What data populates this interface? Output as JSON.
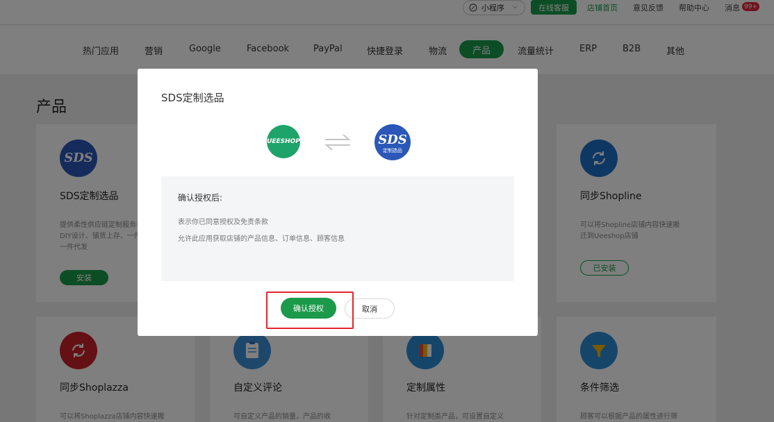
{
  "topbar": {
    "mini_program_label": "小程序",
    "online_service_label": "在线客服",
    "store_home_label": "店铺首页",
    "feedback_label": "意见反馈",
    "help_label": "帮助中心",
    "messages_label": "消息",
    "messages_badge": "99+"
  },
  "nav": {
    "items": [
      "热门应用",
      "营销",
      "Google",
      "Facebook",
      "PayPal",
      "快捷登录",
      "物流",
      "产品",
      "流量统计",
      "ERP",
      "B2B",
      "其他"
    ],
    "active": "产品"
  },
  "page": {
    "section_title": "产品",
    "cards": [
      {
        "name": "SDS定制选品",
        "desc": "提供柔性供应链定制服务丰富，DIY设计、铺货上存、一件起订、一件代发",
        "button": "安装"
      },
      {
        "name": "同步Shopline",
        "desc": "可以将Shopline店铺内容快速搬迁到Ueeshop店铺",
        "button": "已安装"
      },
      {
        "name": "同步Shoplazza",
        "desc": "可以将Shoplazza店铺内容快速搬"
      },
      {
        "name": "自定义评论",
        "desc": "可自定义产品的销量，产品的收"
      },
      {
        "name": "定制属性",
        "desc": "针对定制类产品，可设置自定义"
      },
      {
        "name": "条件筛选",
        "desc": "顾客可以根据产品的属性进行筛"
      }
    ]
  },
  "modal": {
    "title": "SDS定制选品",
    "logo_left_text": "UEESHOP",
    "logo_right_text": "定制选品",
    "info_heading": "确认授权后:",
    "info_lines": [
      "表示你已同意授权及免责条款",
      "允许此应用获取店铺的产品信息、订单信息、顾客信息"
    ],
    "confirm_label": "确认授权",
    "cancel_label": "取消"
  },
  "colors": {
    "brand_green": "#1a9a4a",
    "highlight_red": "#e2262b",
    "sds_blue": "#2a57b8",
    "ueeshop_green": "#1ea36a"
  }
}
